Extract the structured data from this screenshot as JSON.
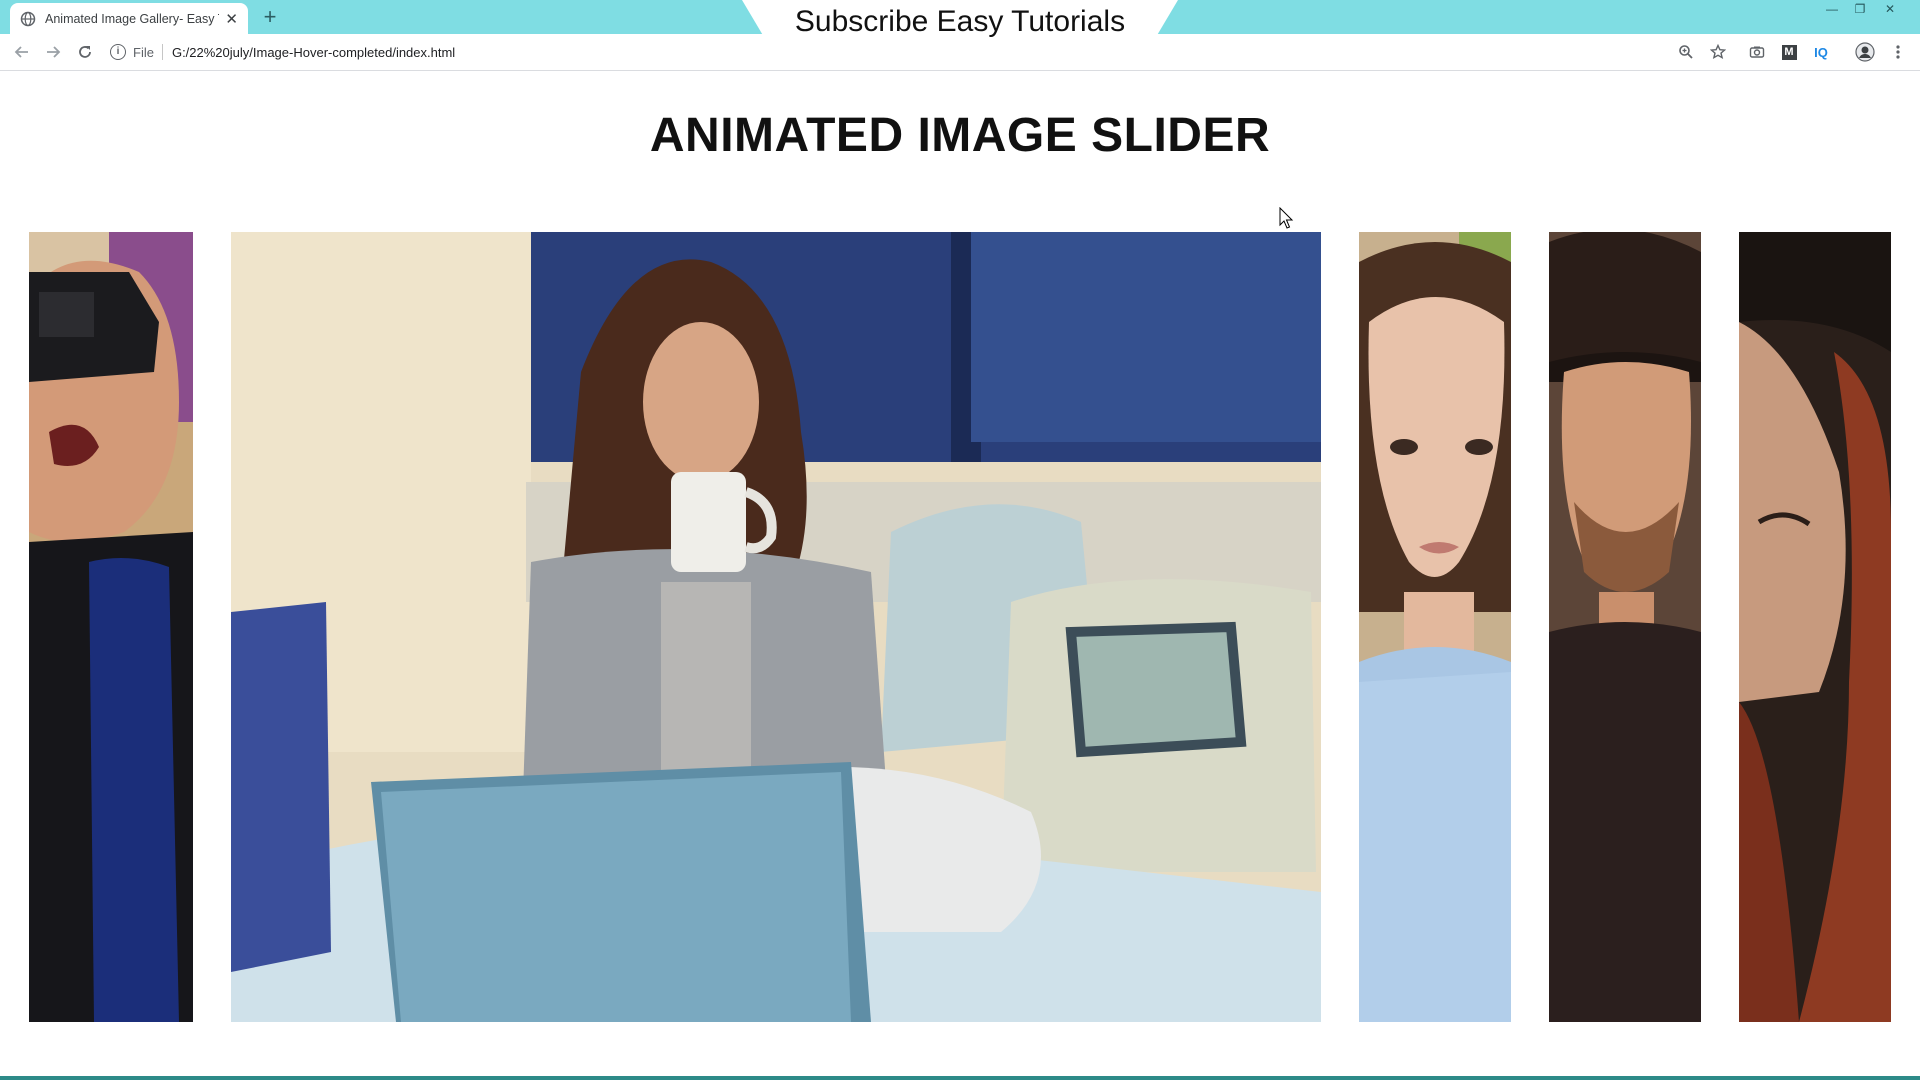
{
  "browser": {
    "tab": {
      "title": "Animated Image Gallery- Easy Tu"
    },
    "banner": "Subscribe Easy Tutorials",
    "address": {
      "scheme": "File",
      "url": "G:/22%20july/Image-Hover-completed/index.html"
    },
    "toolbar_icons": [
      "zoom-icon",
      "bookmark-star-icon",
      "camera-icon",
      "m-extension-icon",
      "iq-extension-icon",
      "profile-avatar-icon",
      "menu-dots-icon"
    ],
    "extension_labels": {
      "m": "M",
      "iq": "IQ"
    }
  },
  "page": {
    "title": "ANIMATED IMAGE SLIDER",
    "slides": [
      {
        "name": "man-vr-headset",
        "active": false
      },
      {
        "name": "woman-coffee-laptop",
        "active": true
      },
      {
        "name": "woman-portrait",
        "active": false
      },
      {
        "name": "man-hat-portrait",
        "active": false
      },
      {
        "name": "redhead-woman-hat",
        "active": false
      }
    ]
  },
  "colors": {
    "tabstrip": "#7fdde3",
    "accent": "#2d8a88"
  }
}
